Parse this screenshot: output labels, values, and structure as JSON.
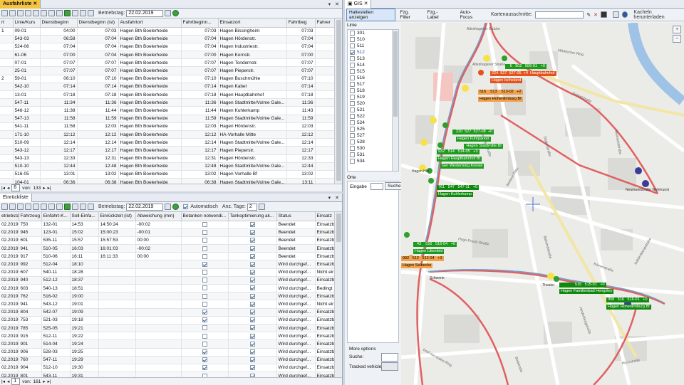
{
  "left_top": {
    "tab_title": "Ausfahrliste",
    "betriebstag_label": "Betriebstag:",
    "betriebstag_value": "22.02.2019",
    "columns": [
      "rt",
      "Linie/Kurs",
      "Dienstbeginn",
      "Dienstbeginn (ist)",
      "Ausfahrtort",
      "Fahrtbeginn...",
      "Einsatzort",
      "Fahrtbeg",
      "Fahrer"
    ],
    "rows": [
      [
        "1",
        "09-01",
        "04:00",
        "07:03",
        "Hagen Bth Boelerheide",
        "07:03",
        "Hagen Bissingheim",
        "07:03"
      ],
      [
        "",
        "543-03",
        "06:58",
        "07:04",
        "Hagen Bth Boelerheide",
        "07:04",
        "Hagen Hördenstr.",
        "07:04"
      ],
      [
        "",
        "524-06",
        "07:04",
        "07:04",
        "Hagen Bth Boelerheide",
        "07:04",
        "Hagen Industriestr.",
        "07:04"
      ],
      [
        "",
        "61-06",
        "07:00",
        "07:04",
        "Hagen Bth Boelerheide",
        "07:00",
        "Hagen Kornstr.",
        "07:00"
      ],
      [
        "",
        "07-01",
        "07:07",
        "07:07",
        "Hagen Bth Boelerheide",
        "07:07",
        "Hagen Tondernstr.",
        "07:07"
      ],
      [
        "",
        "25-01",
        "07:07",
        "07:07",
        "Hagen Bth Boelerheide",
        "07:07",
        "Hagen Pieperstr.",
        "07:07"
      ],
      [
        "2",
        "59-01",
        "06:10",
        "07:10",
        "Hagen Bth Boelerheide",
        "07:10",
        "Hagen Buschmühle",
        "07:10"
      ],
      [
        "",
        "542-10",
        "07:14",
        "07:14",
        "Hagen Bth Boelerheide",
        "07:14",
        "Hagen Kabel",
        "07:14"
      ],
      [
        "",
        "13-01",
        "07:18",
        "07:18",
        "Hagen Bth Boelerheide",
        "07:18",
        "Hagen Hauptbahnhof",
        "07:18"
      ],
      [
        "",
        "547-11",
        "11:34",
        "11:36",
        "Hagen Bth Boelerheide",
        "11:36",
        "Hagen Stadtmitte/Volme Gale...",
        "11:36"
      ],
      [
        "",
        "546-12",
        "11:38",
        "11:44",
        "Hagen Bth Boelerheide",
        "11:44",
        "Hagen Kuhlerkamp",
        "11:43"
      ],
      [
        "",
        "547-13",
        "11:58",
        "11:59",
        "Hagen Bth Boelerheide",
        "11:59",
        "Hagen Stadtmitte/Volme Gale...",
        "11:59"
      ],
      [
        "",
        "541-11",
        "11:58",
        "12:03",
        "Hagen Bth Boelerheide",
        "12:03",
        "Hagen Hördenstr.",
        "12:03"
      ],
      [
        "",
        "171-10",
        "12:12",
        "12:12",
        "Hagen Bth Boelerheide",
        "12:12",
        "HA-Vorhalle Mitte",
        "12:12"
      ],
      [
        "",
        "510-09",
        "12:14",
        "12:14",
        "Hagen Bth Boelerheide",
        "12:14",
        "Hagen Stadtmitte/Volme Gale...",
        "12:14"
      ],
      [
        "",
        "543-12",
        "12:17",
        "12:17",
        "Hagen Bth Boelerheide",
        "12:17",
        "Hagen Pieperstr.",
        "12:17"
      ],
      [
        "",
        "543-13",
        "12:33",
        "12:31",
        "Hagen Bth Boelerheide",
        "12:31",
        "Hagen Hördenstr.",
        "12:33"
      ],
      [
        "",
        "510-10",
        "12:44",
        "12:48",
        "Hagen Bth Boelerheide",
        "12:48",
        "Hagen Stadtmitte/Volme Gale...",
        "12:44"
      ],
      [
        "",
        "516-05",
        "13:01",
        "13:02",
        "Hagen Bth Boelerheide",
        "13:02",
        "Hagen Vorhalle Bf",
        "13:02"
      ],
      [
        "",
        "104-01",
        "06:36",
        "06:38",
        "Hagen Bth Boelerheide",
        "06:38",
        "Hagen Stadtmitte/Volme Gale...",
        "13:11"
      ]
    ],
    "status_von": "von:",
    "status_count": "133",
    "status_page": "6"
  },
  "left_bottom": {
    "tab_title": "Einrückliste",
    "betriebstag_label": "Betriebstag:",
    "betriebstag_value": "22.02.2019",
    "automatisch_label": "Automatisch",
    "anz_tage_label": "Anz. Tage:",
    "anz_tage_value": "2",
    "columns": [
      "etriebstag",
      "Fahrzeug",
      "Einfahrt-K...",
      "Soll-Einfa...",
      "Einrückzeit (ist)",
      "Abweichung (min)",
      "Betanken notwendi...",
      "Tankoptimierung ak...",
      "Status",
      "Einsatz"
    ],
    "rows": [
      [
        "02.2019",
        "750",
        "132-01",
        "14:53",
        "14:50:24",
        "-00:02",
        "off",
        "on",
        "Beendet",
        "Einsatzb"
      ],
      [
        "02.2019",
        "945",
        "123-01",
        "15:02",
        "15:00:23",
        "-00:01",
        "off",
        "on",
        "Beendet",
        "Einsatzb"
      ],
      [
        "02.2019",
        "601",
        "535-11",
        "15:57",
        "15:57:53",
        "00:00",
        "off",
        "on",
        "Beendet",
        "Einsatzb"
      ],
      [
        "02.2019",
        "941",
        "510-05",
        "16:03",
        "16:01:03",
        "-00:02",
        "off",
        "on",
        "Beendet",
        "Einsatzb"
      ],
      [
        "02.2019",
        "917",
        "510-06",
        "16:11",
        "16:11:33",
        "00:00",
        "off",
        "on",
        "Beendet",
        "Einsatzb"
      ],
      [
        "02.2019",
        "992",
        "512-04",
        "18:10",
        "",
        "",
        "on",
        "on",
        "Wird durchgef...",
        "Einsatzb"
      ],
      [
        "02.2019",
        "607",
        "540-11",
        "18:28",
        "",
        "",
        "off",
        "on",
        "Wird durchgef...",
        "Nicht eir"
      ],
      [
        "02.2019",
        "940",
        "512-12",
        "18:37",
        "",
        "",
        "off",
        "on",
        "Wird durchgef...",
        "Einsatzb"
      ],
      [
        "02.2019",
        "603",
        "540-13",
        "18:51",
        "",
        "",
        "off",
        "on",
        "Wird durchgef...",
        "Bedingt"
      ],
      [
        "02.2019",
        "762",
        "516-02",
        "19:00",
        "",
        "",
        "off",
        "on",
        "Wird durchgef...",
        "Einsatzb"
      ],
      [
        "02.2019",
        "941",
        "543-12",
        "19:01",
        "",
        "",
        "off",
        "on",
        "Wird durchgef...",
        "Nicht eir"
      ],
      [
        "02.2019",
        "804",
        "542-07",
        "19:09",
        "",
        "",
        "on",
        "on",
        "Wird durchgef...",
        "Einsatzb"
      ],
      [
        "02.2019",
        "753",
        "521-03",
        "19:18",
        "",
        "",
        "on",
        "on",
        "Wird durchgef...",
        "Einsatzb"
      ],
      [
        "02.2019",
        "785",
        "525-05",
        "19:21",
        "",
        "",
        "off",
        "on",
        "Wird durchgef...",
        "Einsatzb"
      ],
      [
        "02.2019",
        "915",
        "512-11",
        "19:22",
        "",
        "",
        "off",
        "on",
        "Wird durchgef...",
        "Einsatzb"
      ],
      [
        "02.2019",
        "901",
        "514-04",
        "19:24",
        "",
        "",
        "off",
        "on",
        "Wird durchgef...",
        "Einsatzb"
      ],
      [
        "02.2019",
        "906",
        "528-03",
        "19:25",
        "",
        "",
        "on",
        "on",
        "Wird durchgef...",
        "Einsatzb"
      ],
      [
        "02.2019",
        "760",
        "547-11",
        "19:29",
        "",
        "",
        "on",
        "on",
        "Wird durchgef...",
        "Einsatzb"
      ],
      [
        "02.2019",
        "904",
        "512-10",
        "19:30",
        "",
        "",
        "on",
        "on",
        "Wird durchgef...",
        "Einsatzb"
      ],
      [
        "02.2019",
        "801",
        "543-11",
        "19:31",
        "",
        "",
        "off",
        "on",
        "Wird durchgef...",
        "Einsatzb"
      ]
    ],
    "status_von": "von:",
    "status_count": "161",
    "status_page": "1"
  },
  "gis": {
    "tab_title": "GIS",
    "btn_haltestellen": "Haltestellen anzeigen",
    "btn_fzg_filter": "Fzg. Filter",
    "btn_fzg_label": "Fzg.-Label",
    "btn_autofocus": "Auto-Focus",
    "kartenausschnitte_label": "Kartenausschnitte:",
    "btn_kacheln": "Kacheln herunterladen",
    "linie_label": "Linie",
    "lines": [
      {
        "n": "301",
        "checked": false
      },
      {
        "n": "510",
        "checked": false
      },
      {
        "n": "511",
        "checked": false
      },
      {
        "n": "512",
        "checked": true
      },
      {
        "n": "513",
        "checked": false
      },
      {
        "n": "514",
        "checked": false
      },
      {
        "n": "515",
        "checked": false
      },
      {
        "n": "516",
        "checked": false
      },
      {
        "n": "517",
        "checked": false
      },
      {
        "n": "518",
        "checked": false
      },
      {
        "n": "519",
        "checked": false
      },
      {
        "n": "520",
        "checked": false
      },
      {
        "n": "521",
        "checked": false
      },
      {
        "n": "522",
        "checked": false
      },
      {
        "n": "524",
        "checked": false
      },
      {
        "n": "525",
        "checked": false
      },
      {
        "n": "527",
        "checked": false
      },
      {
        "n": "528",
        "checked": false
      },
      {
        "n": "530",
        "checked": false
      },
      {
        "n": "531",
        "checked": false
      },
      {
        "n": "534",
        "checked": false
      }
    ],
    "orte_label": "Orte",
    "eingabe_label": "Eingabe",
    "btn_suche": "Suche",
    "more_options_label": "More options",
    "suche_label": "Suche:",
    "tracked_vehicle_label": "Tracked vehicle",
    "colors": {
      "green": "#1e9a1e",
      "red": "#e4531c",
      "orange": "#f3a14a",
      "route": "#e06060"
    },
    "map_labels": {
      "streets": [
        "Gorbelstraße",
        "Hugo-Preuß-Straße",
        "Graf-von-Galen-Ring",
        "Frankfurter Straße",
        "Neumarktstraße",
        "Körnerstraße",
        "Bahnhofstraße",
        "Hochstraße",
        "Altenhagener Brücke",
        "Altenhagener Straße",
        "Dödterstraße",
        "Berliner Platz",
        "Märkischer Ring",
        "Badstraße",
        "Hindenburgstraße",
        "Dahlenkampstraße"
      ],
      "stops": [
        "Neumarktstraße Wehrkunst",
        "Theater",
        "Schwerte",
        "Hagen Hbf"
      ]
    },
    "vehicle_labels": [
      {
        "text": "   6   502   506-01   +0",
        "color": "green"
      },
      {
        "text": "224  527  527-05  +4  Hauptbahnhof",
        "color": "red"
      },
      {
        "text": "Hagen Ischeland",
        "color": "red"
      },
      {
        "text": "516    513    513-02   +2",
        "color": "orange"
      },
      {
        "text": "Hagen Hohenlimburg Bf",
        "color": "orange"
      },
      {
        "text": "  220  527  527-08  +0",
        "color": "green"
      },
      {
        "text": "Hagen Fuhrparker",
        "color": "green"
      },
      {
        "text": " Hagen Stadtmitte Bf",
        "color": "green"
      },
      {
        "text": "932   514   514-05   +3",
        "color": "green"
      },
      {
        "text": "Hagen Hauptbahnhof Bf",
        "color": "green"
      },
      {
        "text": "Ger Westerbürg Kreisel",
        "color": "green"
      },
      {
        "text": "761   547   547-11   +0",
        "color": "dkgreen"
      },
      {
        "text": "Hagen Kuhlerkamp",
        "color": "dkgreen"
      },
      {
        "text": "  43    516   516-04   +0",
        "color": "green"
      },
      {
        "text": "Hagen Lilienfeld",
        "color": "green"
      },
      {
        "text": "992   512   512-04   +3",
        "color": "orange"
      },
      {
        "text": "Hagen Selbecke",
        "color": "orange"
      },
      {
        "text": "             515   515-01   +0",
        "color": "dkgreen"
      },
      {
        "text": "Hagen Familienbad Hengstey",
        "color": "dkgreen"
      },
      {
        "text": "908   516   516-01   +0",
        "color": "dkgreen"
      },
      {
        "text": "Hagen Hohenlimburg Bf",
        "color": "dkgreen"
      }
    ]
  }
}
